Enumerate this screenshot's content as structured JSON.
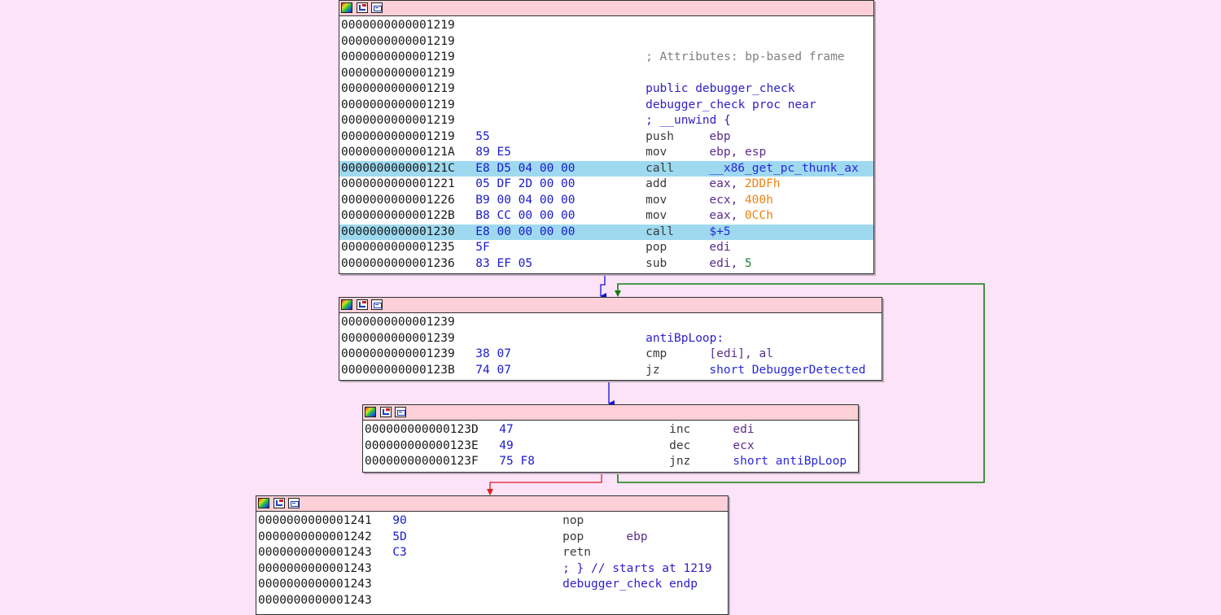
{
  "colors": {
    "background": "#fde3f8",
    "node_title": "#fdd0d8",
    "highlight": "#9ed9f0",
    "edge_true": "#1010e0",
    "edge_false": "#e02020",
    "edge_back": "#108010"
  },
  "title_icons": [
    "color-palette-icon",
    "graph-overview-icon",
    "group-nodes-icon"
  ],
  "nodes": [
    {
      "id": "node-1219",
      "lines": [
        {
          "addr": "0000000000001219",
          "bytes": "",
          "mnem": "",
          "ops": []
        },
        {
          "addr": "0000000000001219",
          "bytes": "",
          "mnem": "",
          "ops": []
        },
        {
          "addr": "0000000000001219",
          "bytes": "",
          "mnem": "",
          "ops": [
            {
              "t": "; Attributes: bp-based frame",
              "c": "cmt"
            }
          ]
        },
        {
          "addr": "0000000000001219",
          "bytes": "",
          "mnem": "",
          "ops": []
        },
        {
          "addr": "0000000000001219",
          "bytes": "",
          "mnem": "",
          "ops": [
            {
              "t": "public debugger_check",
              "c": "lbl"
            }
          ]
        },
        {
          "addr": "0000000000001219",
          "bytes": "",
          "mnem": "",
          "ops": [
            {
              "t": "debugger_check proc near",
              "c": "lbl"
            }
          ]
        },
        {
          "addr": "0000000000001219",
          "bytes": "",
          "mnem": "",
          "ops": [
            {
              "t": "; __unwind {",
              "c": "lbl"
            }
          ]
        },
        {
          "addr": "0000000000001219",
          "bytes": "55",
          "mnem": "push",
          "ops": [
            {
              "t": "ebp",
              "c": "op"
            }
          ]
        },
        {
          "addr": "000000000000121A",
          "bytes": "89 E5",
          "mnem": "mov",
          "ops": [
            {
              "t": "ebp, esp",
              "c": "op"
            }
          ]
        },
        {
          "addr": "000000000000121C",
          "bytes": "E8 D5 04 00 00",
          "mnem": "call",
          "ops": [
            {
              "t": "__x86_get_pc_thunk_ax",
              "c": "sym"
            }
          ],
          "hl": true
        },
        {
          "addr": "0000000000001221",
          "bytes": "05 DF 2D 00 00",
          "mnem": "add",
          "ops": [
            {
              "t": "eax, ",
              "c": "op"
            },
            {
              "t": "2DDFh",
              "c": "num"
            }
          ]
        },
        {
          "addr": "0000000000001226",
          "bytes": "B9 00 04 00 00",
          "mnem": "mov",
          "ops": [
            {
              "t": "ecx, ",
              "c": "op"
            },
            {
              "t": "400h",
              "c": "num"
            }
          ]
        },
        {
          "addr": "000000000000122B",
          "bytes": "B8 CC 00 00 00",
          "mnem": "mov",
          "ops": [
            {
              "t": "eax, ",
              "c": "op"
            },
            {
              "t": "0CCh",
              "c": "num"
            }
          ]
        },
        {
          "addr": "0000000000001230",
          "bytes": "E8 00 00 00 00",
          "mnem": "call",
          "ops": [
            {
              "t": "$+5",
              "c": "sym"
            }
          ],
          "hl": true
        },
        {
          "addr": "0000000000001235",
          "bytes": "5F",
          "mnem": "pop",
          "ops": [
            {
              "t": "edi",
              "c": "op"
            }
          ]
        },
        {
          "addr": "0000000000001236",
          "bytes": "83 EF 05",
          "mnem": "sub",
          "ops": [
            {
              "t": "edi, ",
              "c": "op"
            },
            {
              "t": "5",
              "c": "imm"
            }
          ]
        }
      ]
    },
    {
      "id": "node-1239",
      "lines": [
        {
          "addr": "0000000000001239",
          "bytes": "",
          "mnem": "",
          "ops": []
        },
        {
          "addr": "0000000000001239",
          "bytes": "",
          "mnem": "",
          "ops": [
            {
              "t": "antiBpLoop:",
              "c": "lbl"
            }
          ]
        },
        {
          "addr": "0000000000001239",
          "bytes": "38 07",
          "mnem": "cmp",
          "ops": [
            {
              "t": "[edi], al",
              "c": "op"
            }
          ]
        },
        {
          "addr": "000000000000123B",
          "bytes": "74 07",
          "mnem": "jz",
          "ops": [
            {
              "t": "short DebuggerDetected",
              "c": "sym"
            }
          ]
        }
      ]
    },
    {
      "id": "node-123d",
      "lines": [
        {
          "addr": "000000000000123D",
          "bytes": "47",
          "mnem": "inc",
          "ops": [
            {
              "t": "edi",
              "c": "op"
            }
          ]
        },
        {
          "addr": "000000000000123E",
          "bytes": "49",
          "mnem": "dec",
          "ops": [
            {
              "t": "ecx",
              "c": "op"
            }
          ]
        },
        {
          "addr": "000000000000123F",
          "bytes": "75 F8",
          "mnem": "jnz",
          "ops": [
            {
              "t": "short antiBpLoop",
              "c": "sym"
            }
          ]
        }
      ]
    },
    {
      "id": "node-1241",
      "lines": [
        {
          "addr": "0000000000001241",
          "bytes": "90",
          "mnem": "nop",
          "ops": []
        },
        {
          "addr": "0000000000001242",
          "bytes": "5D",
          "mnem": "pop",
          "ops": [
            {
              "t": "ebp",
              "c": "op"
            }
          ]
        },
        {
          "addr": "0000000000001243",
          "bytes": "C3",
          "mnem": "retn",
          "ops": []
        },
        {
          "addr": "0000000000001243",
          "bytes": "",
          "mnem": "",
          "ops": [
            {
              "t": "; } // starts at 1219",
              "c": "lbl"
            }
          ]
        },
        {
          "addr": "0000000000001243",
          "bytes": "",
          "mnem": "",
          "ops": [
            {
              "t": "debugger_check endp",
              "c": "lbl"
            }
          ]
        },
        {
          "addr": "0000000000001243",
          "bytes": "",
          "mnem": "",
          "ops": []
        }
      ]
    }
  ]
}
